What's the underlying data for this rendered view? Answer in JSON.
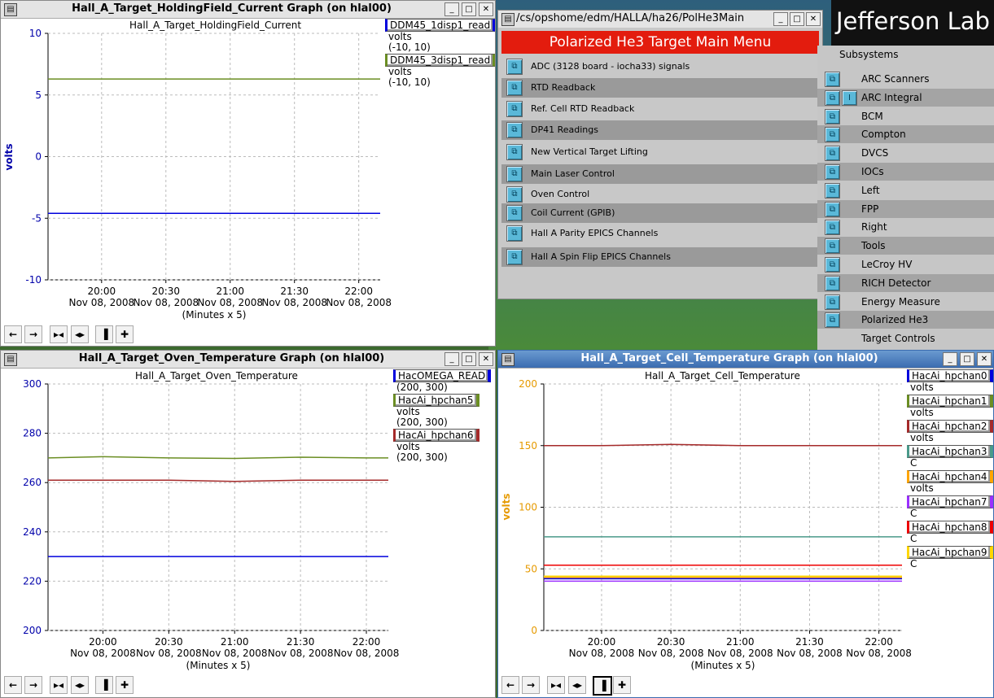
{
  "holding": {
    "title": "Hall_A_Target_HoldingField_Current Graph (on hlal00)",
    "plot_title": "Hall_A_Target_HoldingField_Current",
    "legend": [
      {
        "name": "DDM45_1disp1_read",
        "units": "volts",
        "range": "(-10, 10)",
        "color": "#0000dd"
      },
      {
        "name": "DDM45_3disp1_read",
        "units": "volts",
        "range": "(-10, 10)",
        "color": "#6b8e23"
      }
    ]
  },
  "oven": {
    "title": "Hall_A_Target_Oven_Temperature Graph (on hlal00)",
    "plot_title": "Hall_A_Target_Oven_Temperature",
    "legend": [
      {
        "name": "HacOMEGA_READ",
        "units": "",
        "range": "(200, 300)",
        "color": "#0000dd"
      },
      {
        "name": "HacAi_hpchan5",
        "units": "volts",
        "range": "(200, 300)",
        "color": "#6b8e23"
      },
      {
        "name": "HacAi_hpchan6",
        "units": "volts",
        "range": "(200, 300)",
        "color": "#a52a2a"
      }
    ]
  },
  "cell": {
    "title": "Hall_A_Target_Cell_Temperature Graph (on hlal00)",
    "plot_title": "Hall_A_Target_Cell_Temperature",
    "legend": [
      {
        "name": "HacAi_hpchan0",
        "units": "volts",
        "color": "#0000dd"
      },
      {
        "name": "HacAi_hpchan1",
        "units": "volts",
        "color": "#6b8e23"
      },
      {
        "name": "HacAi_hpchan2",
        "units": "volts",
        "color": "#a52a2a"
      },
      {
        "name": "HacAi_hpchan3",
        "units": "C",
        "color": "#4a9a8a"
      },
      {
        "name": "HacAi_hpchan4",
        "units": "volts",
        "color": "#ffa500"
      },
      {
        "name": "HacAi_hpchan7",
        "units": "C",
        "color": "#9b30ff"
      },
      {
        "name": "HacAi_hpchan8",
        "units": "C",
        "color": "#ee0000"
      },
      {
        "name": "HacAi_hpchan9",
        "units": "C",
        "color": "#ffd700"
      }
    ]
  },
  "menu": {
    "title": "/cs/opshome/edm/HALLA/ha26/PolHe3Main",
    "header": "Polarized He3 Target Main Menu",
    "items": [
      "ADC (3128 board - iocha33) signals",
      "RTD Readback",
      "Ref. Cell RTD Readback",
      "DP41 Readings",
      "New Vertical Target Lifting",
      "Main Laser Control",
      "Oven Control",
      "Coil Current (GPIB)",
      "Hall A Parity EPICS Channels",
      "Hall A Spin Flip EPICS Channels"
    ]
  },
  "jlab": {
    "logo_text": "Jefferson Lab"
  },
  "subsystems": {
    "title": "Subsystems",
    "items": [
      "ARC Scanners",
      "ARC Integral",
      "BCM",
      "Compton",
      "DVCS",
      "IOCs",
      "Left",
      "FPP",
      "Right",
      "Tools",
      "LeCroy HV",
      "RICH Detector",
      "Energy Measure",
      "Polarized He3",
      "Target Controls"
    ]
  },
  "toolbar_icons": [
    "left-arrow",
    "right-arrow",
    "zoom-in-x",
    "zoom-out-x",
    "pin",
    "add"
  ],
  "chart_data": [
    {
      "type": "line",
      "title": "Hall_A_Target_HoldingField_Current",
      "ylabel": "volts",
      "ylim": [
        -10,
        10
      ],
      "yticks": [
        "10",
        "5",
        "0",
        "-5",
        "-10"
      ],
      "xticks": [
        "20:00",
        "20:30",
        "21:00",
        "21:30",
        "22:00"
      ],
      "xdate": "Nov 08, 2008",
      "xlabel": "(Minutes x 5)",
      "grid": true,
      "x": [
        "19:35",
        "20:00",
        "20:30",
        "21:00",
        "21:30",
        "22:00",
        "22:10"
      ],
      "series": [
        {
          "name": "DDM45_1disp1_read",
          "values": [
            -4.6,
            -4.6,
            -4.6,
            -4.6,
            -4.6,
            -4.6,
            -4.6
          ],
          "color": "#0000dd"
        },
        {
          "name": "DDM45_3disp1_read",
          "values": [
            6.3,
            6.3,
            6.3,
            6.3,
            6.3,
            6.3,
            6.3
          ],
          "color": "#6b8e23"
        }
      ]
    },
    {
      "type": "line",
      "title": "Hall_A_Target_Oven_Temperature",
      "ylabel": "",
      "ylim": [
        200,
        300
      ],
      "yticks": [
        "300",
        "280",
        "260",
        "240",
        "220",
        "200"
      ],
      "xticks": [
        "20:00",
        "20:30",
        "21:00",
        "21:30",
        "22:00"
      ],
      "xdate": "Nov 08, 2008",
      "xlabel": "(Minutes x 5)",
      "grid": true,
      "x": [
        "19:35",
        "20:00",
        "20:30",
        "21:00",
        "21:30",
        "22:00",
        "22:10"
      ],
      "series": [
        {
          "name": "HacOMEGA_READ",
          "values": [
            230,
            230,
            230,
            230,
            230,
            230,
            230
          ],
          "color": "#0000dd"
        },
        {
          "name": "HacAi_hpchan5",
          "values": [
            270,
            270.5,
            270,
            269.8,
            270.3,
            270,
            270
          ],
          "color": "#6b8e23"
        },
        {
          "name": "HacAi_hpchan6",
          "values": [
            261,
            261,
            261,
            260.5,
            261,
            261,
            261
          ],
          "color": "#a52a2a"
        }
      ]
    },
    {
      "type": "line",
      "title": "Hall_A_Target_Cell_Temperature",
      "ylabel": "volts",
      "ylim": [
        0,
        200
      ],
      "yticks": [
        "200",
        "150",
        "100",
        "50",
        "0"
      ],
      "xticks": [
        "20:00",
        "20:30",
        "21:00",
        "21:30",
        "22:00"
      ],
      "xdate": "Nov 08, 2008",
      "xlabel": "(Minutes x 5)",
      "grid": true,
      "x": [
        "19:35",
        "20:00",
        "20:30",
        "21:00",
        "21:30",
        "22:00",
        "22:10"
      ],
      "series": [
        {
          "name": "HacAi_hpchan2",
          "values": [
            150,
            150,
            151,
            150,
            150,
            150,
            150
          ],
          "color": "#a52a2a"
        },
        {
          "name": "HacAi_hpchan3",
          "values": [
            76,
            76,
            76,
            76,
            76,
            76,
            76
          ],
          "color": "#4a9a8a"
        },
        {
          "name": "HacAi_hpchan8",
          "values": [
            53,
            53,
            53,
            53,
            53,
            53,
            53
          ],
          "color": "#ee0000"
        },
        {
          "name": "HacAi_hpchan9",
          "values": [
            44,
            44,
            44,
            44,
            44,
            44,
            44
          ],
          "color": "#ffd700"
        },
        {
          "name": "HacAi_hpchan4",
          "values": [
            43,
            43,
            43,
            43,
            43,
            43,
            43
          ],
          "color": "#ffa500"
        },
        {
          "name": "HacAi_hpchan0",
          "values": [
            42,
            42,
            42,
            42,
            42,
            42,
            42
          ],
          "color": "#0000dd"
        },
        {
          "name": "HacAi_hpchan7",
          "values": [
            40,
            40,
            40,
            40,
            40,
            40,
            40
          ],
          "color": "#9b30ff"
        }
      ]
    }
  ]
}
